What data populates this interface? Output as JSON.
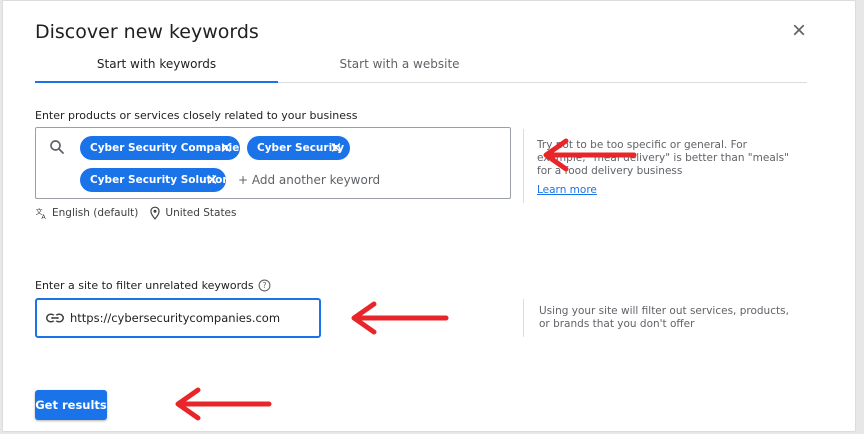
{
  "dialog": {
    "title": "Discover new keywords",
    "close_icon": "close-icon"
  },
  "tabs": [
    {
      "label": "Start with keywords",
      "active": true
    },
    {
      "label": "Start with a website",
      "active": false
    }
  ],
  "keywords_section": {
    "label": "Enter products or services closely related to your business",
    "chips": [
      {
        "label": "Cyber Security Companies"
      },
      {
        "label": "Cyber Security"
      },
      {
        "label": "Cyber Security Solution"
      }
    ],
    "add_placeholder": "+ Add another keyword",
    "language": "English (default)",
    "location": "United States",
    "help_text": "Try not to be too specific or general. For example, \"meal delivery\" is better than \"meals\" for a food delivery business",
    "learn_more": "Learn more"
  },
  "site_section": {
    "label": "Enter a site to filter unrelated keywords",
    "value": "https://cybersecuritycompanies.com",
    "help_text": "Using your site will filter out services, products, or brands that you don't offer"
  },
  "actions": {
    "get_results": "Get results"
  },
  "colors": {
    "accent": "#1a73e8",
    "annotation_arrow": "#e8262a"
  }
}
